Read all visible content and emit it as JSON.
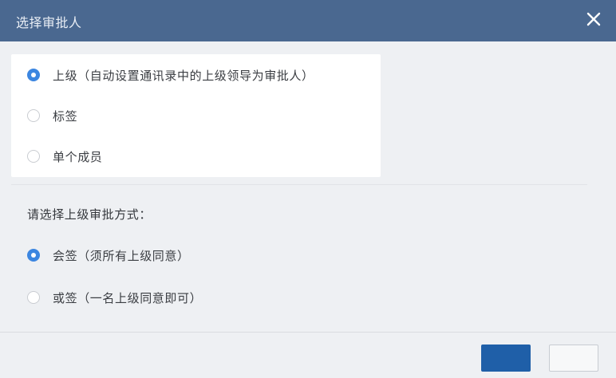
{
  "dialog": {
    "title": "选择审批人",
    "close_icon": "close-icon"
  },
  "approver_type": {
    "options": [
      {
        "label": "上级（自动设置通讯录中的上级领导为审批人）",
        "selected": true
      },
      {
        "label": "标签",
        "selected": false
      },
      {
        "label": "单个成员",
        "selected": false
      }
    ]
  },
  "approval_mode": {
    "prompt": "请选择上级审批方式：",
    "options": [
      {
        "label": "会签（须所有上级同意）",
        "selected": true
      },
      {
        "label": "或签（一名上级同意即可）",
        "selected": false
      }
    ]
  },
  "colors": {
    "titlebar": "#4a6890",
    "accent": "#3c86e0",
    "primary_button": "#1f5fa8"
  }
}
